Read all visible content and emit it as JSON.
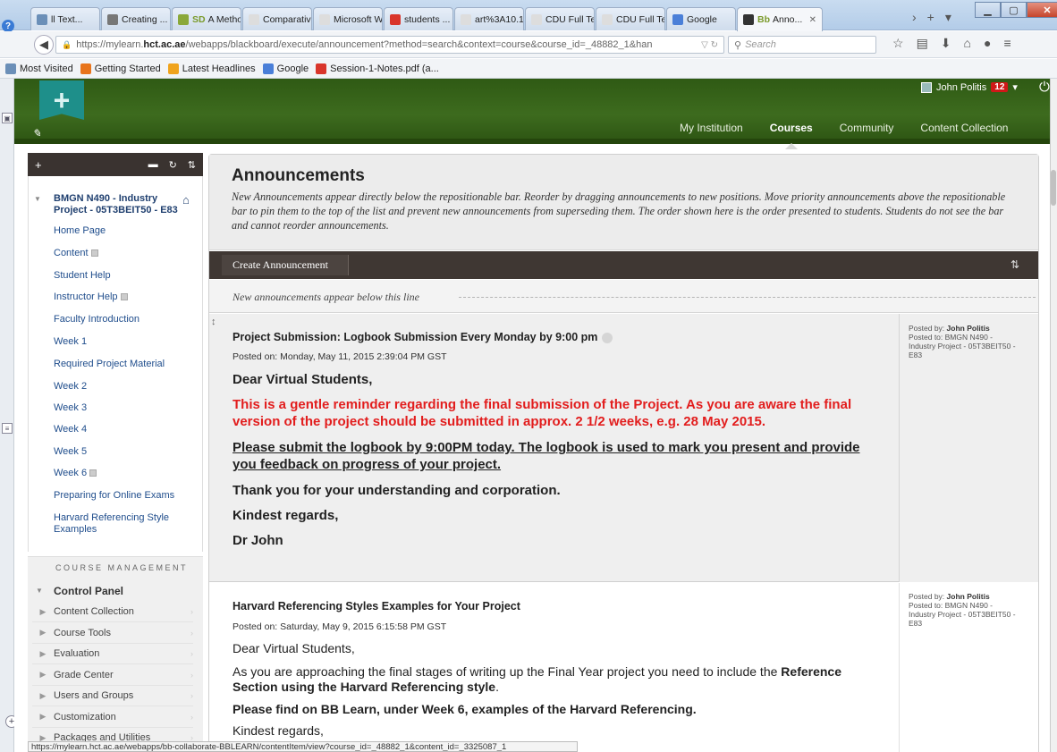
{
  "browser": {
    "tabs": [
      {
        "label": "ll Text...",
        "color": "#6b8fb8"
      },
      {
        "label": "Creating ...",
        "color": "#777777"
      },
      {
        "label": "A Metho...",
        "color": "#8aa83a",
        "prefix": "SD"
      },
      {
        "label": "Comparative ...",
        "color": "#dddddd"
      },
      {
        "label": "Microsoft Wo...",
        "color": "#dddddd"
      },
      {
        "label": "students ...",
        "color": "#d9352b"
      },
      {
        "label": "art%3A10.100...",
        "color": "#dddddd"
      },
      {
        "label": "CDU Full Text...",
        "color": "#dddddd"
      },
      {
        "label": "CDU Full Text...",
        "color": "#dddddd"
      },
      {
        "label": "Google",
        "color": "#4a7fd8"
      },
      {
        "label": "Anno...",
        "color": "#333333",
        "prefix": "Bb"
      }
    ],
    "url_prefix": "https://mylearn.",
    "url_domain": "hct.ac.ae",
    "url_rest": "/webapps/blackboard/execute/announcement?method=search&context=course&course_id=_48882_1&han",
    "search_placeholder": "Search",
    "bookmarks": [
      {
        "label": "Most Visited",
        "color": "#6b8fb8"
      },
      {
        "label": "Getting Started",
        "color": "#e8741c"
      },
      {
        "label": "Latest Headlines",
        "color": "#f0a31c"
      },
      {
        "label": "Google",
        "color": "#4a7fd8"
      },
      {
        "label": "Session-1-Notes.pdf (a...",
        "color": "#d9352b"
      }
    ],
    "status_url": "https://mylearn.hct.ac.ae/webapps/bb-collaborate-BBLEARN/contentItem/view?course_id=_48882_1&content_id=_3325087_1"
  },
  "header": {
    "user_name": "John Politis",
    "notification_count": "12",
    "nav": [
      "My Institution",
      "Courses",
      "Community",
      "Content Collection"
    ],
    "selected_nav": "Courses"
  },
  "course_menu": {
    "course_title": "BMGN N490 - Industry Project - 05T3BEIT50 - E83",
    "items": [
      {
        "label": "Home Page"
      },
      {
        "label": "Content",
        "mark": true
      },
      {
        "label": "Student Help"
      },
      {
        "label": "Instructor Help",
        "mark": true
      },
      {
        "label": "Faculty Introduction"
      },
      {
        "label": "Week 1"
      },
      {
        "label": "Required Project Material"
      },
      {
        "label": "Week 2"
      },
      {
        "label": "Week 3"
      },
      {
        "label": "Week 4"
      },
      {
        "label": "Week 5"
      },
      {
        "label": "Week 6",
        "mark": true
      },
      {
        "label": "Preparing for Online Exams"
      },
      {
        "label": "Harvard Referencing Style Examples"
      }
    ],
    "management_label": "COURSE MANAGEMENT",
    "control_panel": "Control Panel",
    "control_items": [
      "Content Collection",
      "Course Tools",
      "Evaluation",
      "Grade Center",
      "Users and Groups",
      "Customization",
      "Packages and Utilities"
    ]
  },
  "announcements": {
    "title": "Announcements",
    "description": "New Announcements appear directly below the repositionable bar. Reorder by dragging announcements to new positions. Move priority announcements above the repositionable bar to pin them to the top of the list and prevent new announcements from superseding them. The order shown here is the order presented to students. Students do not see the bar and cannot reorder announcements.",
    "create_button": "Create Announcement",
    "repositionable_text": "New announcements appear below this line",
    "items": [
      {
        "title": "Project Submission: Logbook Submission Every Monday by 9:00 pm",
        "posted_on": "Posted on: Monday, May 11, 2015 2:39:04 PM GST",
        "posted_by_label": "Posted by:",
        "posted_by": "John Politis",
        "posted_to": "Posted to: BMGN N490 - Industry Project - 05T3BEIT50 - E83",
        "greeting": "Dear Virtual Students,",
        "reminder": "This is a gentle reminder regarding the final submission of the Project. As you are aware the final version of the project should be submitted in approx. 2 1/2 weeks, e.g. 28 May 2015.",
        "logbook": "Please submit the logbook by 9:00PM today. The logbook is used to mark you present and provide you feedback on progress of your project.",
        "thanks": "Thank you for your understanding and corporation.",
        "regards": "Kindest  regards,",
        "signature": "Dr John"
      },
      {
        "title": "Harvard Referencing Styles Examples for Your Project",
        "posted_on": "Posted on: Saturday, May 9, 2015 6:15:58 PM GST",
        "posted_by_label": "Posted by:",
        "posted_by": "John Politis",
        "posted_to": "Posted to: BMGN N490 - Industry Project - 05T3BEIT50 - E83",
        "greeting": "Dear Virtual Students,",
        "para_start": "As you are approaching the final stages of writing up the Final Year project you need to include the ",
        "para_bold": "Reference Section using the Harvard Referencing style",
        "para_end": ".",
        "find": "Please find on BB Learn, under Week 6, examples of the Harvard Referencing.",
        "regards": "Kindest regards,"
      }
    ]
  }
}
